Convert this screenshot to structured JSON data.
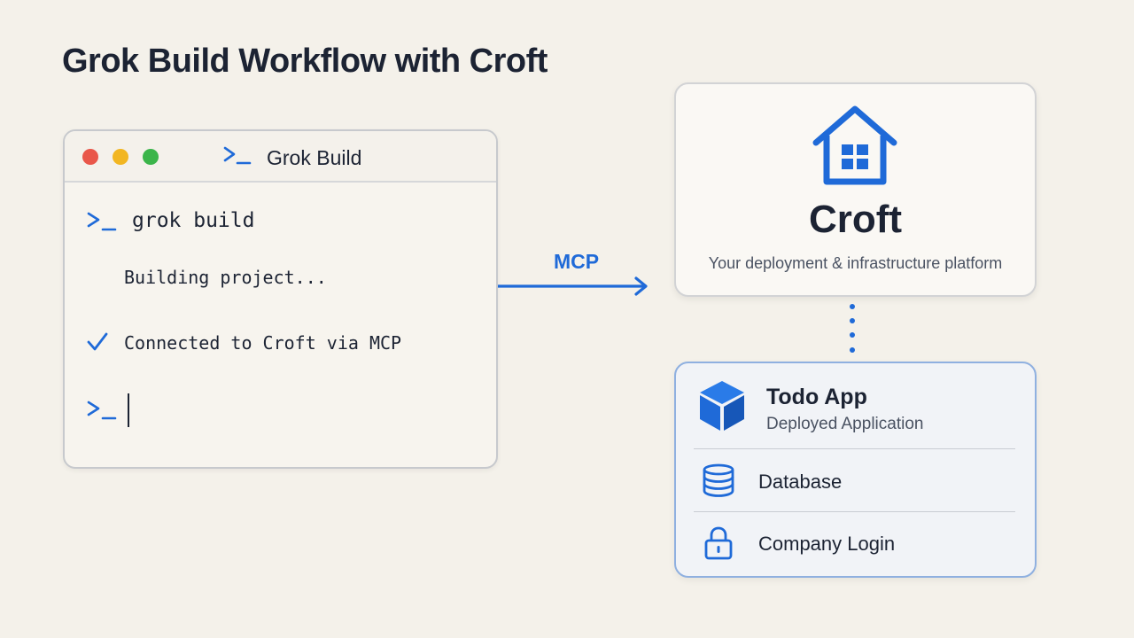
{
  "title": "Grok Build Workflow with Croft",
  "terminal": {
    "window_title": "Grok Build",
    "command": "grok build",
    "status_line": "Building project...",
    "success_line": "Connected to Croft via MCP"
  },
  "connection": {
    "label": "MCP"
  },
  "croft": {
    "name": "Croft",
    "tagline": "Your deployment & infrastructure platform"
  },
  "app": {
    "name": "Todo App",
    "subtitle": "Deployed Application",
    "resources": [
      {
        "label": "Database",
        "icon": "database-icon"
      },
      {
        "label": "Company Login",
        "icon": "lock-icon"
      }
    ]
  },
  "colors": {
    "accent": "#1f6ad8",
    "text": "#1c2333",
    "background": "#f4f1ea",
    "traffic_red": "#e9574a",
    "traffic_yellow": "#f2b621",
    "traffic_green": "#3bb54a"
  }
}
